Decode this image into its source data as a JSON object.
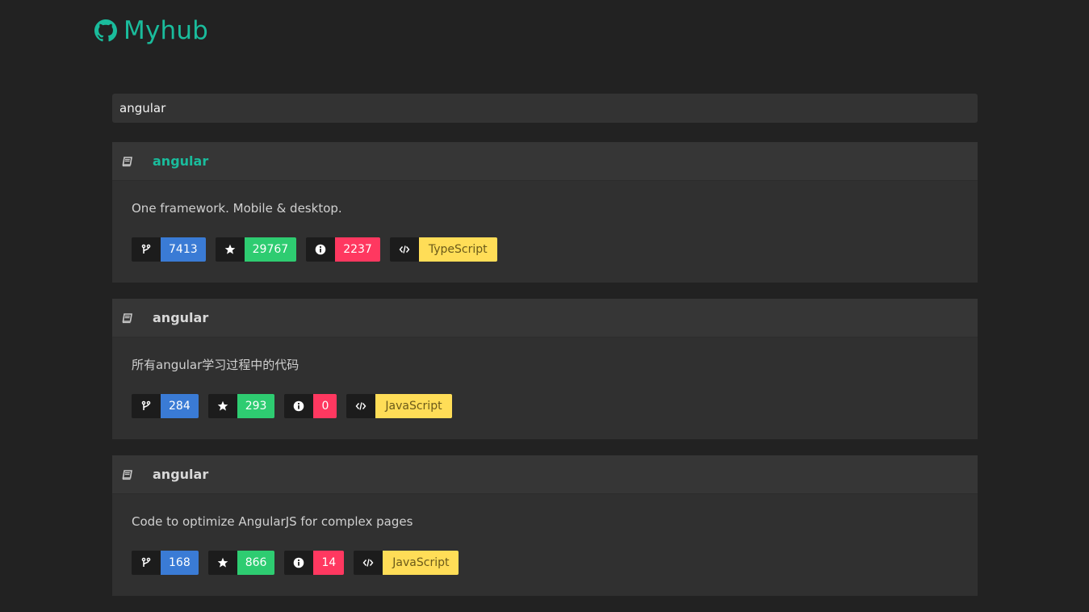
{
  "brand": {
    "name": "Myhub",
    "icon": "github-icon",
    "color": "#1abc9c"
  },
  "search": {
    "value": "angular",
    "placeholder": ""
  },
  "results": [
    {
      "name": "angular",
      "highlighted": true,
      "description": "One framework. Mobile & desktop.",
      "forks": "7413",
      "stars": "29767",
      "issues": "2237",
      "language": "TypeScript"
    },
    {
      "name": "angular",
      "highlighted": false,
      "description": "所有angular学习过程中的代码",
      "forks": "284",
      "stars": "293",
      "issues": "0",
      "language": "JavaScript"
    },
    {
      "name": "angular",
      "highlighted": false,
      "description": "Code to optimize AngularJS for complex pages",
      "forks": "168",
      "stars": "866",
      "issues": "14",
      "language": "JavaScript"
    }
  ],
  "colors": {
    "accent": "#1abc9c",
    "forks": "#3a7bd5",
    "stars": "#2ecc71",
    "issues": "#ff3860",
    "language": "#ffdd57"
  }
}
